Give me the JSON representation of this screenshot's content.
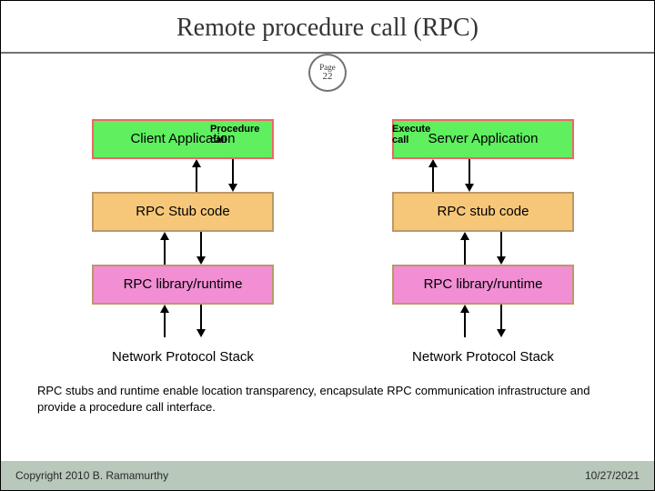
{
  "title": "Remote procedure call (RPC)",
  "page_label": "Page",
  "page_number": "22",
  "labels": {
    "procedure_call": "Procedure call",
    "execute_call": "Execute call"
  },
  "client": {
    "app": "Client Application",
    "stub": "RPC Stub code",
    "runtime": "RPC library/runtime",
    "net": "Network Protocol Stack"
  },
  "server": {
    "app": "Server Application",
    "stub": "RPC stub code",
    "runtime": "RPC library/runtime",
    "net": "Network Protocol Stack"
  },
  "caption": "RPC stubs and runtime enable location transparency, encapsulate RPC communication infrastructure and provide a procedure call interface.",
  "footer": {
    "copyright": "Copyright 2010 B. Ramamurthy",
    "date": "10/27/2021"
  }
}
